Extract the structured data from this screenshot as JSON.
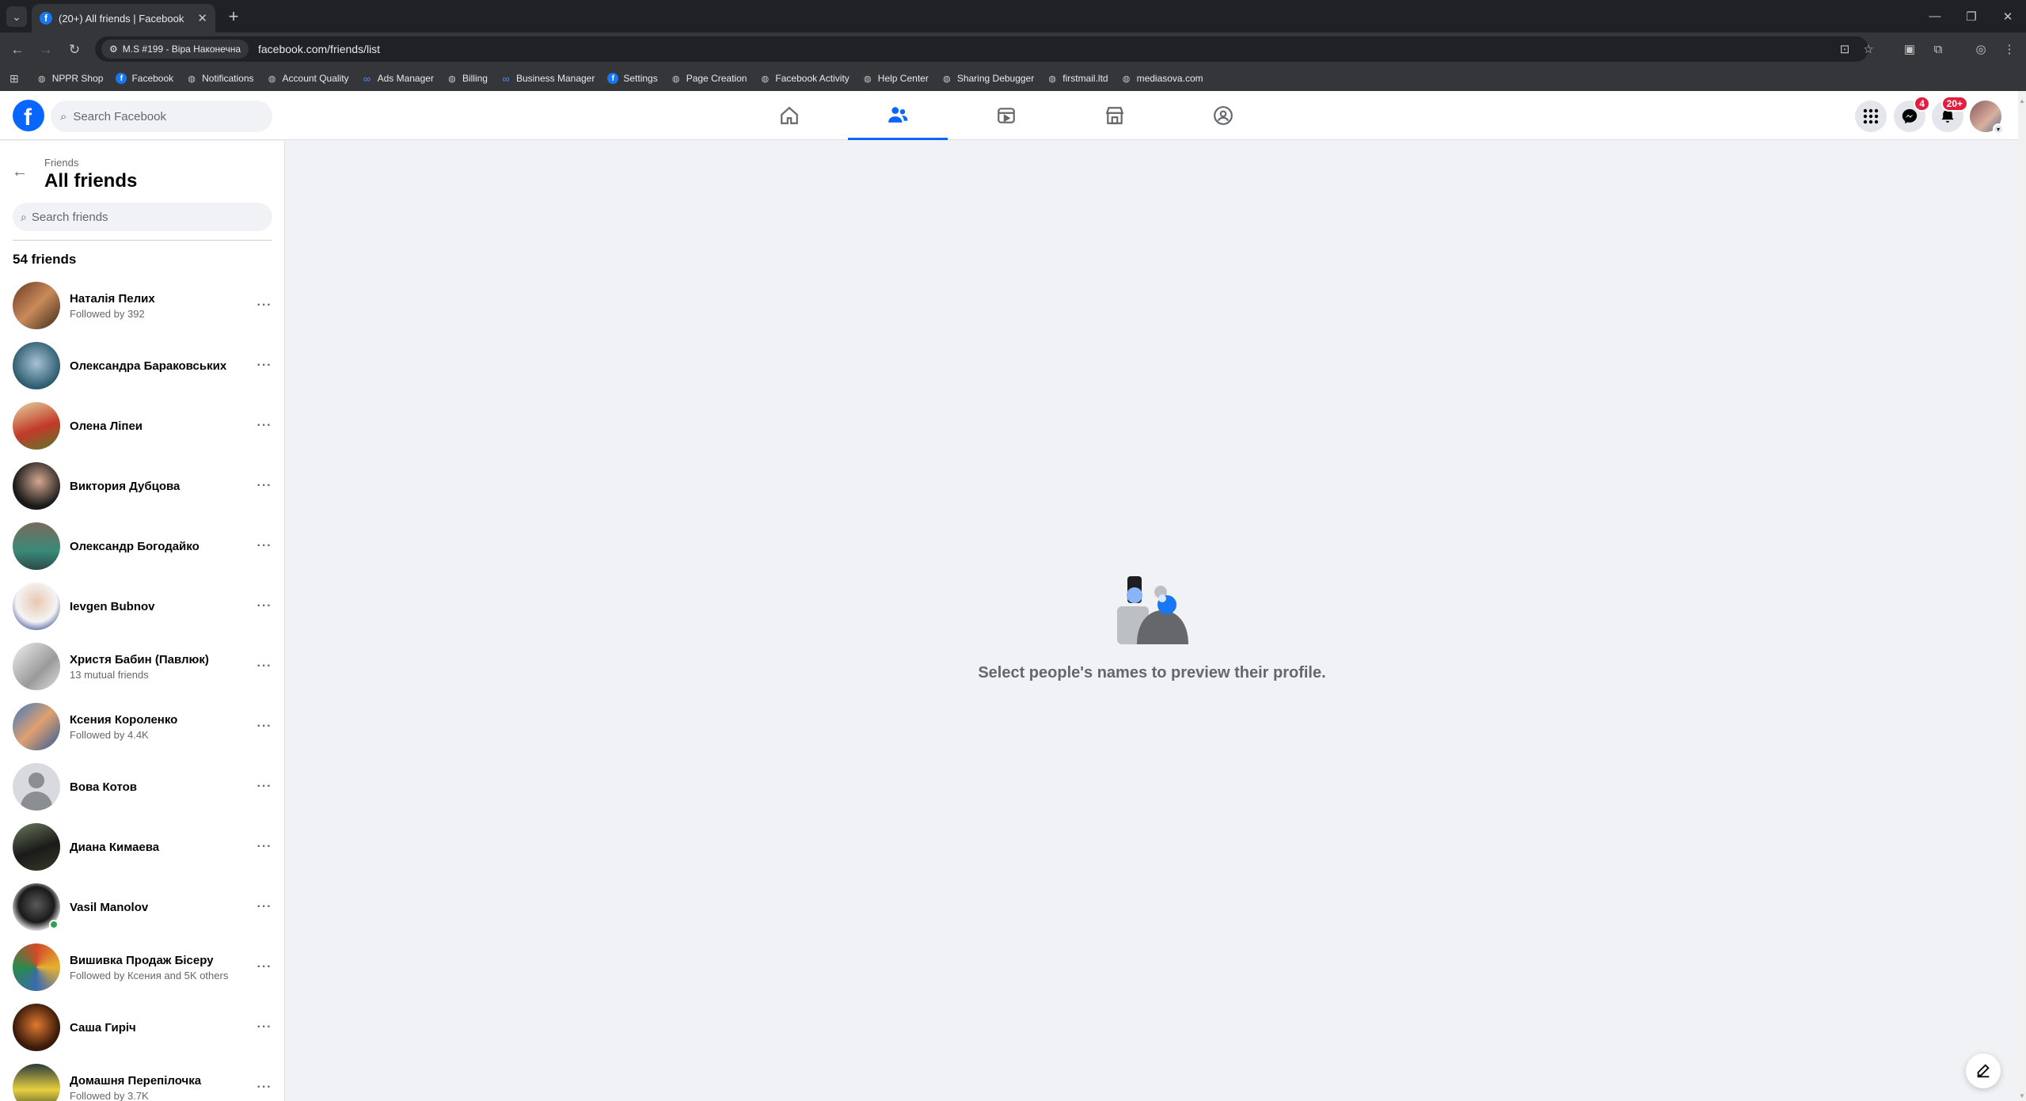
{
  "browser": {
    "tab_title": "(20+) All friends | Facebook",
    "profile_chip": "M.S #199 - Віра Наконечна",
    "url": "facebook.com/friends/list",
    "bookmarks": [
      {
        "label": "NPPR Shop",
        "icon": "globe-icon"
      },
      {
        "label": "Facebook",
        "icon": "facebook-icon"
      },
      {
        "label": "Notifications",
        "icon": "globe-icon"
      },
      {
        "label": "Account Quality",
        "icon": "globe-icon"
      },
      {
        "label": "Ads Manager",
        "icon": "meta-icon"
      },
      {
        "label": "Billing",
        "icon": "globe-icon"
      },
      {
        "label": "Business Manager",
        "icon": "meta-icon"
      },
      {
        "label": "Settings",
        "icon": "facebook-icon"
      },
      {
        "label": "Page Creation",
        "icon": "globe-icon"
      },
      {
        "label": "Facebook Activity",
        "icon": "globe-icon"
      },
      {
        "label": "Help Center",
        "icon": "globe-icon"
      },
      {
        "label": "Sharing Debugger",
        "icon": "globe-icon"
      },
      {
        "label": "firstmail.ltd",
        "icon": "globe-icon"
      },
      {
        "label": "mediasova.com",
        "icon": "globe-icon"
      }
    ]
  },
  "header": {
    "logo": "f",
    "search_placeholder": "Search Facebook",
    "messenger_badge": "4",
    "notifications_badge": "20+",
    "accent": "#0866ff"
  },
  "sidebar": {
    "breadcrumb": "Friends",
    "title": "All friends",
    "search_placeholder": "Search friends",
    "count": "54 friends",
    "friends": [
      {
        "name": "Наталія Пелих",
        "sub": "Followed by 392"
      },
      {
        "name": "Олександра Бараковських",
        "sub": ""
      },
      {
        "name": "Олена Ліпеи",
        "sub": ""
      },
      {
        "name": "Виктория Дубцова",
        "sub": ""
      },
      {
        "name": "Олександр Богодайко",
        "sub": ""
      },
      {
        "name": "Ievgen Bubnov",
        "sub": ""
      },
      {
        "name": "Христя Бабин (Павлюк)",
        "sub": "13 mutual friends"
      },
      {
        "name": "Ксения Короленко",
        "sub": "Followed by 4.4K"
      },
      {
        "name": "Вова Котов",
        "sub": ""
      },
      {
        "name": "Диана Кимаева",
        "sub": ""
      },
      {
        "name": "Vasil Manolov",
        "sub": ""
      },
      {
        "name": "Вишивка Продаж Бісеру",
        "sub": "Followed by Ксения and 5K others"
      },
      {
        "name": "Саша Гиріч",
        "sub": ""
      },
      {
        "name": "Домашня Перепілочка",
        "sub": "Followed by 3.7K"
      }
    ]
  },
  "main": {
    "empty_text": "Select people's names to preview their profile."
  }
}
